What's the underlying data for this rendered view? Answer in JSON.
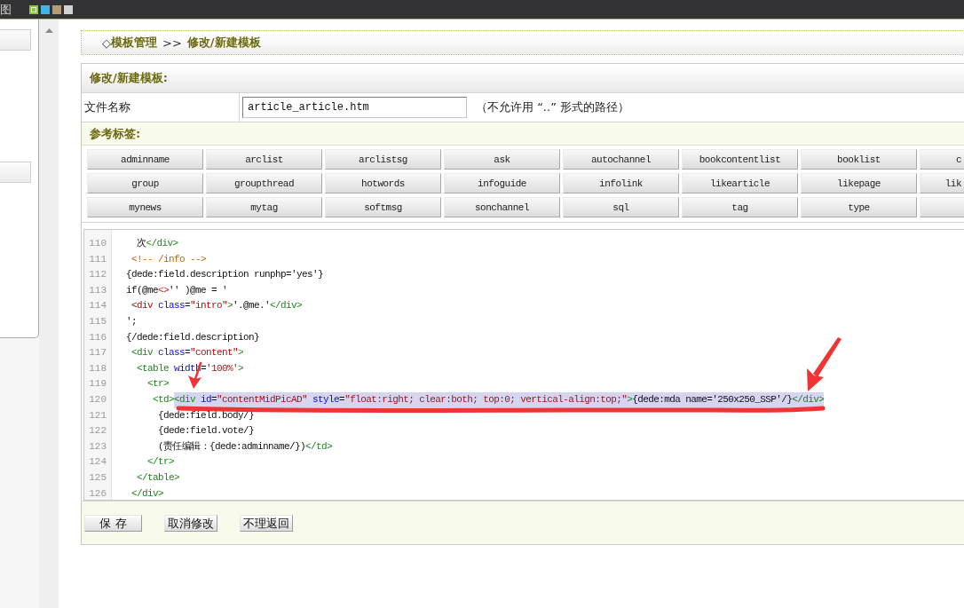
{
  "top_bar": {
    "label": "图",
    "themes": [
      {
        "color": "#8cc63e",
        "selected": true
      },
      {
        "color": "#41b4e6",
        "selected": false
      },
      {
        "color": "#b59c76",
        "selected": false
      },
      {
        "color": "#cfd3d6",
        "selected": false
      }
    ]
  },
  "breadcrumb": {
    "marker": "◇",
    "items": [
      "模板管理",
      "修改/新建模板"
    ],
    "separator": ">>"
  },
  "form": {
    "title": "修改/新建模板:",
    "file_label": "文件名称",
    "file_name": "article_article.htm",
    "file_note": "（不允许用 “..” 形式的路径）",
    "tags_title": "参考标签:",
    "tag_rows": [
      [
        "adminname",
        "arclist",
        "arclistsg",
        "ask",
        "autochannel",
        "bookcontentlist",
        "booklist",
        "c"
      ],
      [
        "group",
        "groupthread",
        "hotwords",
        "infoguide",
        "infolink",
        "likearticle",
        "likepage",
        "lik"
      ],
      [
        "mynews",
        "mytag",
        "softmsg",
        "sonchannel",
        "sql",
        "tag",
        "type"
      ]
    ]
  },
  "editor": {
    "lines": [
      {
        "number": "110",
        "tokens": [
          {
            "kind": "plain",
            "text": "   次"
          },
          {
            "kind": "tag",
            "text": "</div>"
          }
        ]
      },
      {
        "number": "111",
        "tokens": [
          {
            "kind": "comment",
            "text": "  <!-- /info -->"
          }
        ]
      },
      {
        "number": "112",
        "tokens": [
          {
            "kind": "plain",
            "text": " {dede:field.description runphp='yes'}"
          }
        ]
      },
      {
        "number": "113",
        "tokens": [
          {
            "kind": "plain",
            "text": " if(@me"
          },
          {
            "kind": "operator",
            "text": "<>"
          },
          {
            "kind": "plain",
            "text": "'' )@me = '"
          }
        ]
      },
      {
        "number": "114",
        "tokens": [
          {
            "kind": "string",
            "text": "  <div"
          },
          {
            "kind": "attr",
            "text": " class"
          },
          {
            "kind": "plain",
            "text": "="
          },
          {
            "kind": "string",
            "text": "\"intro\""
          },
          {
            "kind": "tag",
            "text": ">"
          },
          {
            "kind": "plain",
            "text": "'.@me.'"
          },
          {
            "kind": "tag",
            "text": "</div>"
          }
        ]
      },
      {
        "number": "115",
        "tokens": [
          {
            "kind": "plain",
            "text": " ';"
          }
        ]
      },
      {
        "number": "116",
        "tokens": [
          {
            "kind": "plain",
            "text": " {/dede:field.description}"
          }
        ]
      },
      {
        "number": "117",
        "tokens": [
          {
            "kind": "tag",
            "text": "  <div"
          },
          {
            "kind": "attr",
            "text": " class"
          },
          {
            "kind": "plain",
            "text": "="
          },
          {
            "kind": "string",
            "text": "\"content\""
          },
          {
            "kind": "tag",
            "text": ">"
          }
        ]
      },
      {
        "number": "118",
        "tokens": [
          {
            "kind": "tag",
            "text": "   <table"
          },
          {
            "kind": "attr",
            "text": " width"
          },
          {
            "kind": "plain",
            "text": "="
          },
          {
            "kind": "string",
            "text": "'100%'"
          },
          {
            "kind": "tag",
            "text": ">"
          }
        ]
      },
      {
        "number": "119",
        "tokens": [
          {
            "kind": "tag",
            "text": "     <tr>"
          }
        ]
      },
      {
        "number": "120",
        "tokens": [
          {
            "kind": "tag",
            "text": "      <td>"
          }
        ],
        "selection": [
          {
            "kind": "tag",
            "text": "<div"
          },
          {
            "kind": "attr",
            "text": " id"
          },
          {
            "kind": "plain",
            "text": "="
          },
          {
            "kind": "string",
            "text": "\"contentMidPicAD\""
          },
          {
            "kind": "attr",
            "text": " style"
          },
          {
            "kind": "plain",
            "text": "="
          },
          {
            "kind": "string",
            "text": "\"float:right; clear:both; top:0; vertical-align:top;\""
          },
          {
            "kind": "tag",
            "text": ">"
          },
          {
            "kind": "plain",
            "text": "{dede:mda name='250x250_SSP'/}"
          },
          {
            "kind": "tag",
            "text": "</div>"
          }
        ]
      },
      {
        "number": "121",
        "tokens": [
          {
            "kind": "plain",
            "text": "       {dede:field.body/}"
          }
        ]
      },
      {
        "number": "122",
        "tokens": [
          {
            "kind": "plain",
            "text": "       {dede:field.vote/}"
          }
        ]
      },
      {
        "number": "123",
        "tokens": [
          {
            "kind": "plain",
            "text": "       (责任编辑：{dede:adminname/})"
          },
          {
            "kind": "tag",
            "text": "</td>"
          }
        ]
      },
      {
        "number": "124",
        "tokens": [
          {
            "kind": "tag",
            "text": "     </tr>"
          }
        ]
      },
      {
        "number": "125",
        "tokens": [
          {
            "kind": "tag",
            "text": "   </table>"
          }
        ]
      },
      {
        "number": "126",
        "tokens": [
          {
            "kind": "tag",
            "text": "  </div>"
          }
        ]
      }
    ]
  },
  "actions": [
    "保 存",
    "取消修改",
    "不理返回"
  ]
}
